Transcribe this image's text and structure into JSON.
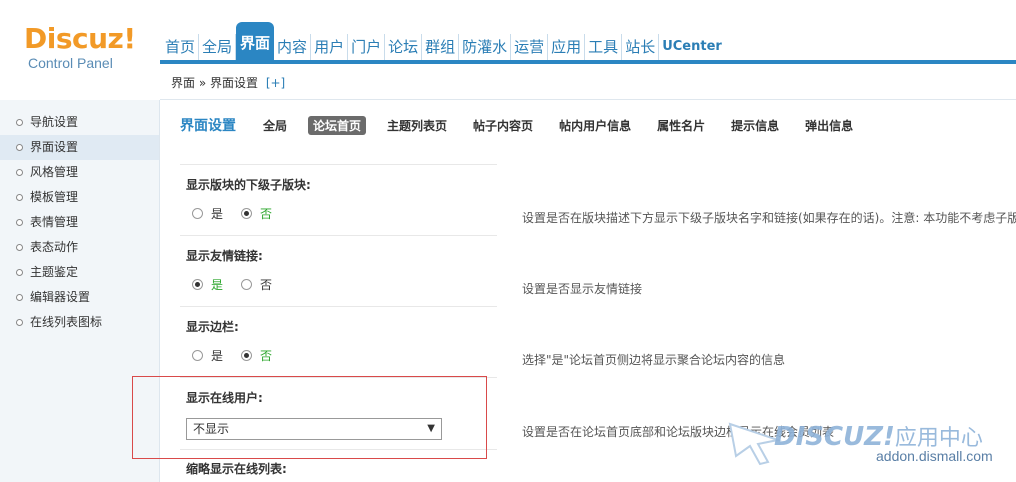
{
  "logo": {
    "main": "Discuz!",
    "sub": "Control Panel"
  },
  "nav": {
    "items": [
      {
        "label": "首页",
        "active": false
      },
      {
        "label": "全局",
        "active": false
      },
      {
        "label": "界面",
        "active": true
      },
      {
        "label": "内容",
        "active": false
      },
      {
        "label": "用户",
        "active": false
      },
      {
        "label": "门户",
        "active": false
      },
      {
        "label": "论坛",
        "active": false
      },
      {
        "label": "群组",
        "active": false
      },
      {
        "label": "防灌水",
        "active": false
      },
      {
        "label": "运营",
        "active": false
      },
      {
        "label": "应用",
        "active": false
      },
      {
        "label": "工具",
        "active": false
      },
      {
        "label": "站长",
        "active": false
      },
      {
        "label": "UCenter",
        "active": false
      }
    ]
  },
  "breadcrumb": {
    "text": "界面 » 界面设置",
    "plus": "[+]"
  },
  "sidebar": {
    "items": [
      {
        "label": "导航设置",
        "active": false
      },
      {
        "label": "界面设置",
        "active": true
      },
      {
        "label": "风格管理",
        "active": false
      },
      {
        "label": "模板管理",
        "active": false
      },
      {
        "label": "表情管理",
        "active": false
      },
      {
        "label": "表态动作",
        "active": false
      },
      {
        "label": "主题鉴定",
        "active": false
      },
      {
        "label": "编辑器设置",
        "active": false
      },
      {
        "label": "在线列表图标",
        "active": false
      }
    ]
  },
  "tabs": {
    "title": "界面设置",
    "items": [
      {
        "label": "全局",
        "active": false
      },
      {
        "label": "论坛首页",
        "active": true
      },
      {
        "label": "主题列表页",
        "active": false
      },
      {
        "label": "帖子内容页",
        "active": false
      },
      {
        "label": "帖内用户信息",
        "active": false
      },
      {
        "label": "属性名片",
        "active": false
      },
      {
        "label": "提示信息",
        "active": false
      },
      {
        "label": "弹出信息",
        "active": false
      }
    ]
  },
  "settings": {
    "subforums": {
      "label": "显示版块的下级子版块:",
      "yes": "是",
      "no": "否",
      "selected": "no",
      "desc": "设置是否在版块描述下方显示下级子版块名字和链接(如果存在的话)。注意: 本功能不考虑子版块"
    },
    "links": {
      "label": "显示友情链接:",
      "yes": "是",
      "no": "否",
      "selected": "yes",
      "desc": "设置是否显示友情链接"
    },
    "sidebar": {
      "label": "显示边栏:",
      "yes": "是",
      "no": "否",
      "selected": "no",
      "desc": "选择\"是\"论坛首页侧边将显示聚合论坛内容的信息"
    },
    "online": {
      "label": "显示在线用户:",
      "value": "不显示",
      "desc": "设置是否在论坛首页底部和论坛版块边栏显示在线会员列表"
    },
    "online_brief": {
      "label": "缩略显示在线列表:"
    }
  },
  "watermark": {
    "main": "DISCUZ!",
    "cn": "应用中心",
    "sub": "addon.dismall.com"
  }
}
